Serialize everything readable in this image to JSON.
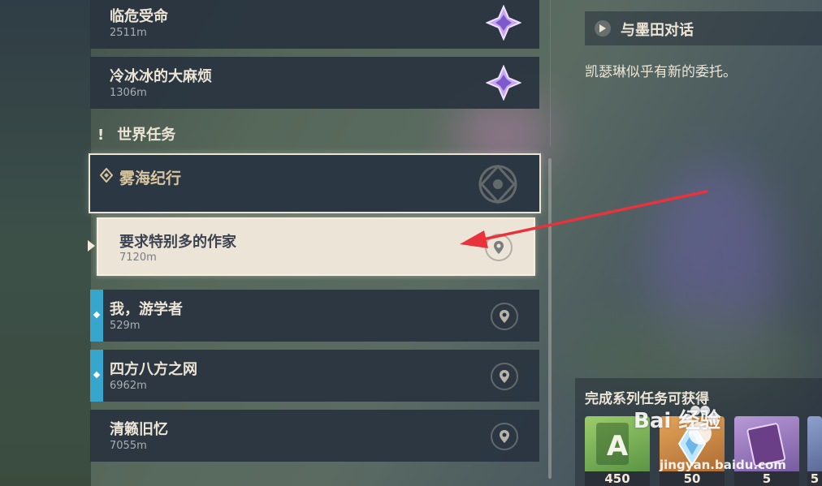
{
  "quests_top": [
    {
      "title": "临危受命",
      "distance": "2511m",
      "badge": "archon-star-icon"
    },
    {
      "title": "冷冰冰的大麻烦",
      "distance": "1306m",
      "badge": "archon-star-icon"
    }
  ],
  "section": {
    "label": "世界任务",
    "icon": "exclamation-icon"
  },
  "series": {
    "title": "雾海纪行",
    "icon": "diamond-marker-icon"
  },
  "selected_quest": {
    "title": "要求特别多的作家",
    "distance": "7120m"
  },
  "quests_bottom": [
    {
      "title": "我，游学者",
      "distance": "529m"
    },
    {
      "title": "四方八方之网",
      "distance": "6962m"
    },
    {
      "title": "清籁旧忆",
      "distance": "7055m"
    }
  ],
  "detail": {
    "step_title": "与墨田对话",
    "description": "凯瑟琳似乎有新的委托。",
    "rewards_label": "完成系列任务可获得",
    "rewards": [
      {
        "name": "adventure-exp",
        "count": "450",
        "color": "#7fae4f"
      },
      {
        "name": "primogem",
        "count": "50",
        "color": "#c9873a"
      },
      {
        "name": "heros-wit-book",
        "count": "5",
        "color": "#8b6fb0"
      },
      {
        "name": "mora",
        "count": "5",
        "color": "#5a6fa3"
      }
    ]
  },
  "watermark": {
    "text": "Bai 经验",
    "sub": "jingyan.baidu.com"
  },
  "colors": {
    "accent_blue": "#38a5cc",
    "panel": "#293440",
    "gold": "#d7c5a0",
    "arrow": "#e8333c"
  }
}
